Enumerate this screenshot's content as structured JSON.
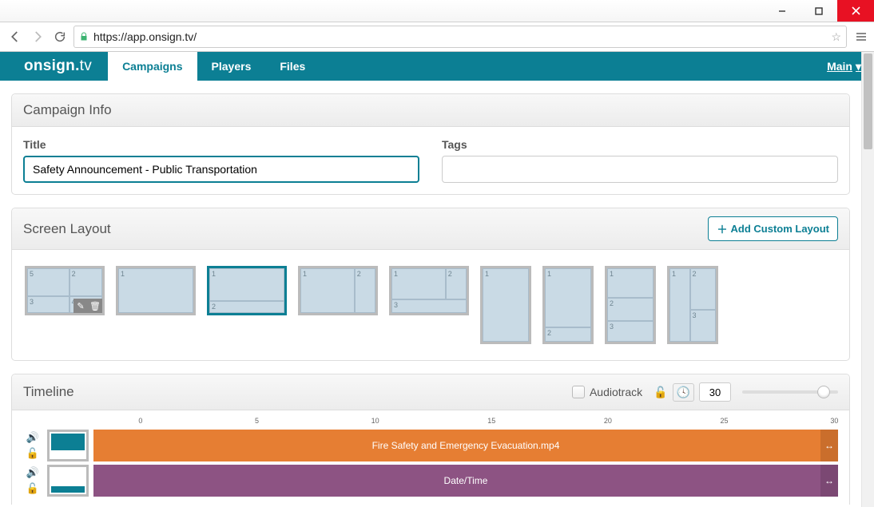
{
  "browser": {
    "url": "https://app.onsign.tv/"
  },
  "nav": {
    "logo": "onsign.tv",
    "tabs": [
      "Campaigns",
      "Players",
      "Files"
    ],
    "active_tab": 0,
    "user_label": "Main"
  },
  "campaign_info": {
    "heading": "Campaign Info",
    "title_label": "Title",
    "title_value": "Safety Announcement - Public Transportation",
    "tags_label": "Tags",
    "tags_value": ""
  },
  "screen_layout": {
    "heading": "Screen Layout",
    "add_button": "Add Custom Layout",
    "selected_index": 2,
    "layouts": [
      {
        "orientation": "landscape",
        "zones": [
          "5",
          "2",
          "3",
          "4"
        ],
        "tools": true
      },
      {
        "orientation": "landscape",
        "zones": [
          "1"
        ]
      },
      {
        "orientation": "landscape",
        "zones": [
          "1",
          "2"
        ]
      },
      {
        "orientation": "landscape",
        "zones": [
          "1",
          "2"
        ]
      },
      {
        "orientation": "landscape",
        "zones": [
          "1",
          "2",
          "3"
        ]
      },
      {
        "orientation": "portrait",
        "zones": [
          "1"
        ]
      },
      {
        "orientation": "portrait",
        "zones": [
          "1",
          "2"
        ]
      },
      {
        "orientation": "portrait",
        "zones": [
          "1",
          "2",
          "3"
        ]
      },
      {
        "orientation": "portrait",
        "zones": [
          "1",
          "2",
          "3"
        ]
      }
    ]
  },
  "timeline": {
    "heading": "Timeline",
    "audiotrack_label": "Audiotrack",
    "audiotrack_checked": false,
    "duration": "30",
    "ruler_ticks": [
      "0",
      "5",
      "10",
      "15",
      "20",
      "25",
      "30"
    ],
    "tracks": [
      {
        "clip_label": "Fire Safety and Emergency Evacuation.mp4",
        "color": "#e67e33",
        "thumb": "top"
      },
      {
        "clip_label": "Date/Time",
        "color": "#8d5383",
        "thumb": "bottom"
      }
    ]
  }
}
